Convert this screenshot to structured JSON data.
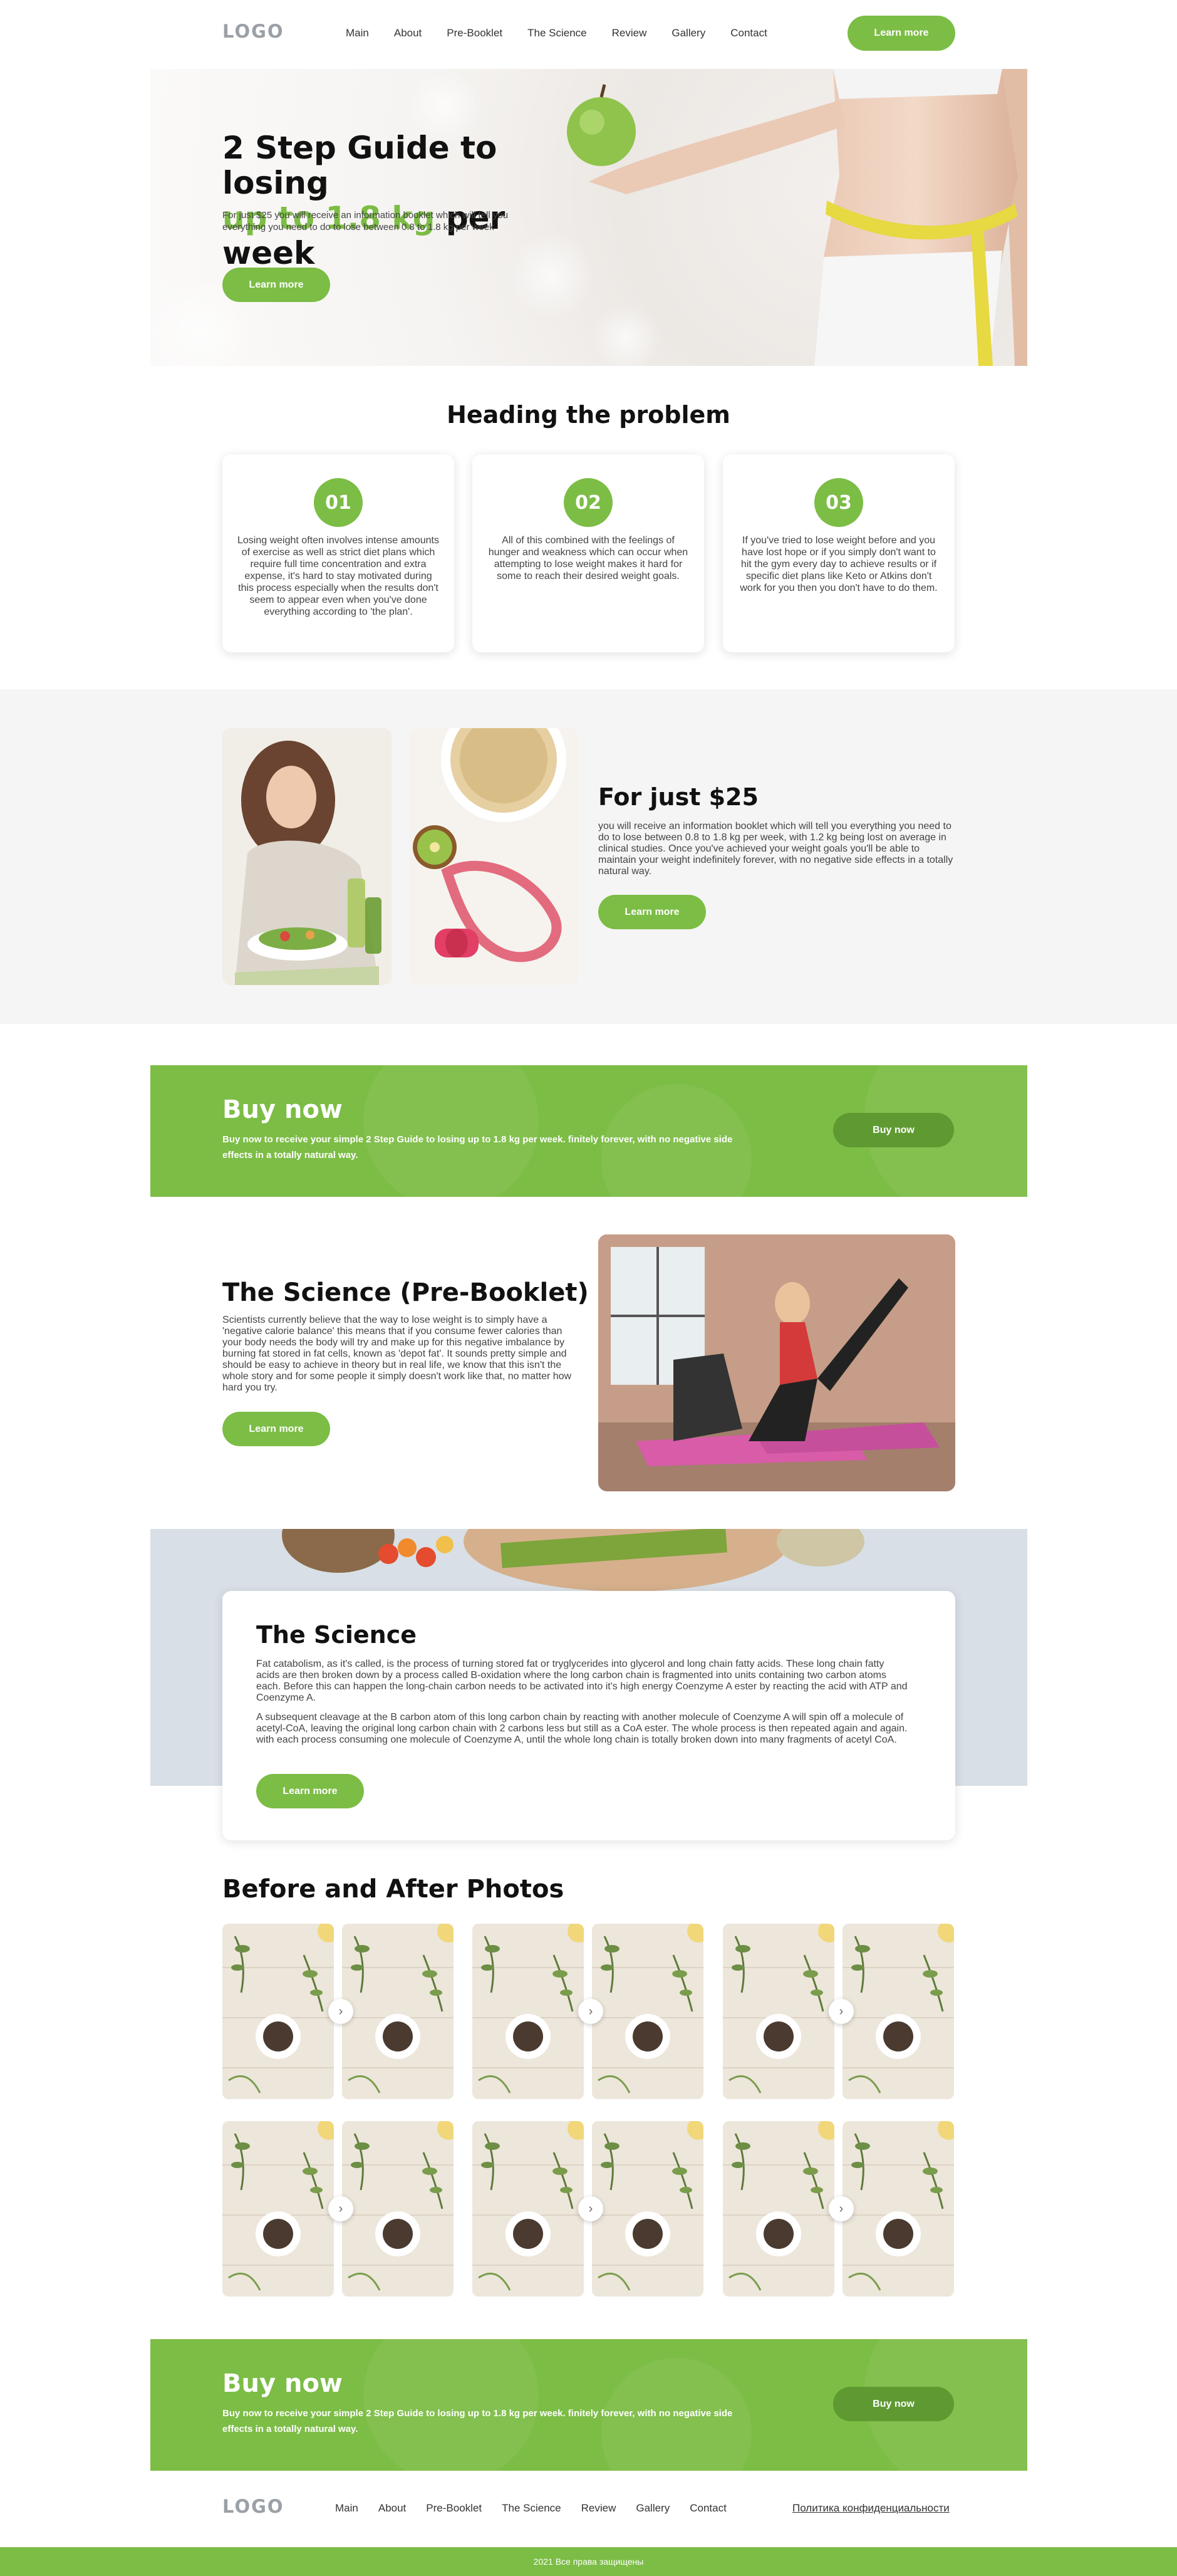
{
  "header": {
    "logo": "LOGO",
    "nav": [
      "Main",
      "About",
      "Pre-Booklet",
      "The Science",
      "Review",
      "Gallery",
      "Contact"
    ],
    "cta": "Learn more"
  },
  "hero": {
    "title_line1": "2 Step Guide to losing",
    "title_green": "up to 1.8 kg",
    "title_rest": " per week",
    "text": "For just $25 you will receive an information booklet which will tell you everything you need to do to lose between 0.8 to 1.8 kg per week",
    "cta": "Learn more"
  },
  "problem": {
    "title": "Heading the problem",
    "cards": [
      {
        "num": "01",
        "text": "Losing weight often involves intense amounts of exercise as well as strict diet plans which require full time concentration and extra expense, it's hard to stay motivated during this process especially when the results don't seem to appear even when you've done everything according to 'the plan'."
      },
      {
        "num": "02",
        "text": "All of this combined with the feelings of hunger and weakness which can occur when attempting to lose weight makes it hard for some to reach their desired weight goals."
      },
      {
        "num": "03",
        "text": "If you've tried to lose weight before and you have lost hope or if you simply don't want to hit the gym every day to achieve results or if specific diet plans like Keto or Atkins don't work for you then you don't have to do them."
      }
    ]
  },
  "offer": {
    "title": "For just $25",
    "text": "you will receive an information booklet which will tell you everything you need to do to lose between 0.8 to 1.8 kg per week, with 1.2 kg being lost on average in clinical studies. Once you've achieved your weight goals you'll be able to maintain your weight indefinitely forever, with no negative side effects in a totally natural way.",
    "cta": "Learn more"
  },
  "buy1": {
    "title": "Buy now",
    "text": "Buy now to receive your simple 2 Step Guide to losing up to 1.8 kg per week. finitely forever, with no negative side effects in a totally natural way.",
    "cta": "Buy now"
  },
  "prebooklet": {
    "title": "The Science (Pre-Booklet)",
    "text": "Scientists currently believe that the way to lose weight is to simply have a 'negative calorie balance' this means that if you consume fewer calories than your body needs the body will try and make up for this negative imbalance by burning fat stored in fat cells, known as 'depot fat'. It sounds pretty simple and should be easy to achieve in theory but in real life, we know that this isn't the whole story and for some people it simply doesn't work like that, no matter how hard you try.",
    "cta": "Learn more"
  },
  "science": {
    "title": "The Science",
    "p1": "Fat catabolism, as it's called, is the process of turning stored fat or tryglycerides into glycerol and long chain fatty acids. These long chain fatty acids are then broken down by a process called B-oxidation where the long carbon chain is fragmented into units containing two carbon atoms each. Before this can happen the long-chain carbon needs to be activated into it's high energy Coenzyme A ester by reacting the acid with ATP and Coenzyme A.",
    "p2": "A subsequent cleavage at the B carbon atom of this long carbon chain by reacting with another molecule of Coenzyme A will spin off a molecule of acetyl-CoA, leaving the original long carbon chain with 2 carbons less but still as a CoA ester. The whole process is then repeated again and again. with each process consuming one molecule of Coenzyme A, until the whole long chain is totally broken down into many fragments of acetyl CoA.",
    "cta": "Learn more"
  },
  "gallery": {
    "title": "Before and After Photos"
  },
  "buy2": {
    "title": "Buy now",
    "text": "Buy now to receive your simple 2 Step Guide to losing up to 1.8 kg per week. finitely forever, with no negative side effects in a totally natural way.",
    "cta": "Buy now"
  },
  "footer": {
    "logo": "LOGO",
    "nav": [
      "Main",
      "About",
      "Pre-Booklet",
      "The Science",
      "Review",
      "Gallery",
      "Contact"
    ],
    "privacy": "Политика конфиденциальности",
    "copyright": "2021 Все права защищены"
  },
  "colors": {
    "accent": "#7cbd45",
    "accent_dark": "#5e9a31",
    "band": "#f5f5f5"
  },
  "icons": {
    "gallery_arrow": "chevron-right-icon"
  }
}
